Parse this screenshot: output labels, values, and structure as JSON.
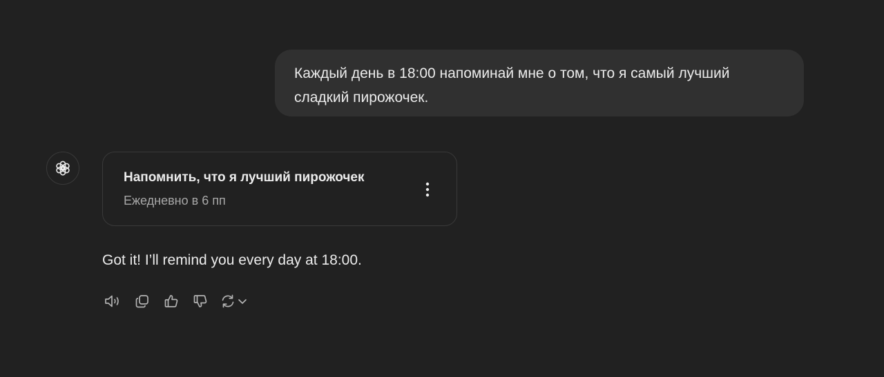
{
  "user_message": {
    "line1": "Каждый день в 18:00 напоминай мне о том, что я самый лучший",
    "line2": "сладкий пирожочек."
  },
  "assistant": {
    "avatar_icon": "openai-logo-icon",
    "task_card": {
      "title": "Напомнить, что я лучший пирожочек",
      "schedule": "Ежедневно в 6 пп",
      "menu_icon": "more-vertical-icon"
    },
    "reply": "Got it! I’ll remind you every day at 18:00.",
    "actions": [
      {
        "icon": "speaker-icon"
      },
      {
        "icon": "copy-icon"
      },
      {
        "icon": "thumbs-up-icon"
      },
      {
        "icon": "thumbs-down-icon"
      },
      {
        "icon": "regenerate-icon"
      },
      {
        "icon": "chevron-down-icon"
      }
    ]
  },
  "colors": {
    "background": "#212121",
    "user_bubble": "#303030",
    "text": "#ececec",
    "muted_text": "#a8a8a8",
    "border": "#3a3a3a"
  }
}
